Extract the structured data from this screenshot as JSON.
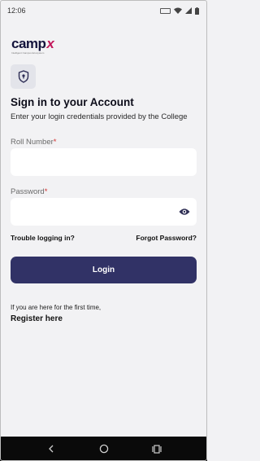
{
  "status_bar": {
    "time": "12:06",
    "icons": [
      "battery-saver-icon",
      "wifi-icon",
      "signal-icon",
      "battery-icon"
    ]
  },
  "logo": {
    "word": "camp",
    "accent": "x",
    "tagline": "Intelligent Campus Ecosystem",
    "colors": {
      "word": "#14143c",
      "accent": "#c2185b"
    }
  },
  "header": {
    "icon": "shield-lock-icon",
    "title": "Sign in to your Account",
    "subtitle": "Enter your login credentials provided  by the College"
  },
  "form": {
    "roll_number": {
      "label": "Roll Number",
      "required_mark": "*",
      "value": ""
    },
    "password": {
      "label": "Password",
      "required_mark": "*",
      "value": "",
      "toggle_icon": "eye-icon"
    },
    "trouble_link": "Trouble logging in?",
    "forgot_link": "Forgot Password?",
    "login_label": "Login"
  },
  "footer": {
    "first_time_text": "If you are here for the first time,",
    "register_link": "Register here"
  },
  "nav_bar": {
    "buttons": [
      "back-icon",
      "home-icon",
      "recents-icon"
    ]
  },
  "colors": {
    "primary_button": "#313266",
    "background": "#f2f2f4",
    "required": "#d32f2f"
  }
}
